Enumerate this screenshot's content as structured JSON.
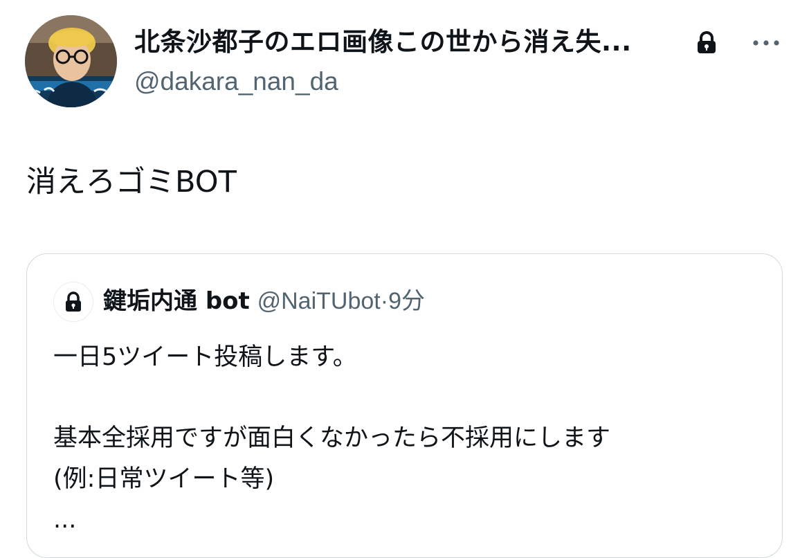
{
  "tweet": {
    "display_name": "北条沙都子のエロ画像この世から消え失...",
    "handle": "@dakara_nan_da",
    "text": "消えろゴミBOT"
  },
  "quoted": {
    "name": "鍵垢内通 bot",
    "handle": "@NaiTUbot",
    "separator": "·",
    "time": "9分",
    "lines": [
      "一日5ツイート投稿します。",
      "基本全採用ですが面白くなかったら不採用にします",
      "(例:日常ツイート等)",
      "..."
    ]
  },
  "icons": {
    "protected": "lock-icon",
    "more": "more-dots-icon"
  },
  "colors": {
    "text": "#0f1419",
    "secondary": "#536471",
    "border": "#cfd9de"
  }
}
